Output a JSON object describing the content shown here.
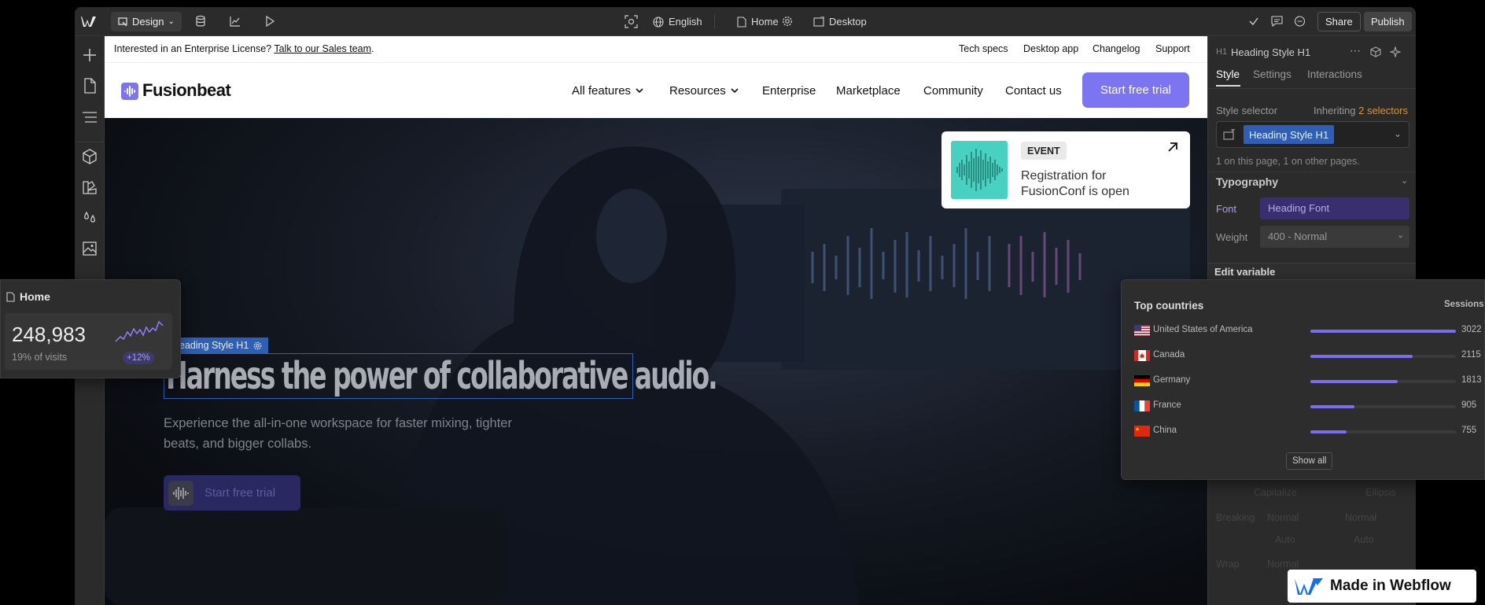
{
  "topbar": {
    "mode_label": "Design",
    "locale": "English",
    "page": "Home",
    "breakpoint": "Desktop",
    "share_label": "Share",
    "publish_label": "Publish"
  },
  "site": {
    "announcement": {
      "text": "Interested in an Enterprise License?",
      "link": "Talk to our Sales team",
      "end": ".",
      "links": [
        "Tech specs",
        "Desktop app",
        "Changelog",
        "Support"
      ]
    },
    "brand": "Fusionbeat",
    "nav": [
      "All features",
      "Resources",
      "Enterprise",
      "Marketplace",
      "Community",
      "Contact us"
    ],
    "cta": "Start free trial",
    "event": {
      "tag": "EVENT",
      "title_line1": "Registration for",
      "title_line2": "FusionConf is open"
    },
    "hero": {
      "selected_label": "Heading Style H1",
      "heading": "Harness the power of collaborative audio.",
      "subtitle_line1": "Experience the all-in-one workspace for faster mixing, tighter",
      "subtitle_line2": "beats, and bigger collabs.",
      "cta": "Start free trial"
    }
  },
  "stats_card": {
    "title": "Home",
    "value": "248,983",
    "caption": "19% of visits",
    "change": "+12%"
  },
  "countries_card": {
    "title": "Top countries",
    "column": "Sessions",
    "rows": [
      {
        "name": "United States of America",
        "value": "3022",
        "ratio": 1.0,
        "flag": "us"
      },
      {
        "name": "Canada",
        "value": "2115",
        "ratio": 0.7,
        "flag": "ca"
      },
      {
        "name": "Germany",
        "value": "1813",
        "ratio": 0.6,
        "flag": "de"
      },
      {
        "name": "France",
        "value": "905",
        "ratio": 0.3,
        "flag": "fr"
      },
      {
        "name": "China",
        "value": "755",
        "ratio": 0.25,
        "flag": "cn"
      }
    ],
    "show_all": "Show all"
  },
  "right_panel": {
    "element_tag": "H1",
    "element_name": "Heading Style H1",
    "tabs": [
      "Style",
      "Settings",
      "Interactions"
    ],
    "selector_label": "Style selector",
    "inheriting_text": "Inheriting",
    "inheriting_count": "2 selectors",
    "selector_chip": "Heading Style H1",
    "usage": "1 on this page, 1 on other pages.",
    "typography": "Typography",
    "font_label": "Font",
    "font_value": "Heading Font",
    "weight_label": "Weight",
    "weight_value": "400 - Normal",
    "edit_variable": "Edit variable",
    "faded_row1_a": "Capitalize",
    "faded_row1_b": "Ellipsis",
    "faded_label2": "Breaking",
    "faded_row2_a": "Normal",
    "faded_row2_b": "Normal",
    "faded_row3_a": "Auto",
    "faded_row3_b": "Auto",
    "faded_label4": "Wrap",
    "faded_row4_a": "Normal"
  },
  "badge": {
    "label": "Made in Webflow"
  },
  "colors": {
    "accent": "#7b6df0",
    "cta_bg": "#7d74f2",
    "selection": "#2f5fb4",
    "variable": "#3a2f6e",
    "event_art": "#48d1c0"
  }
}
